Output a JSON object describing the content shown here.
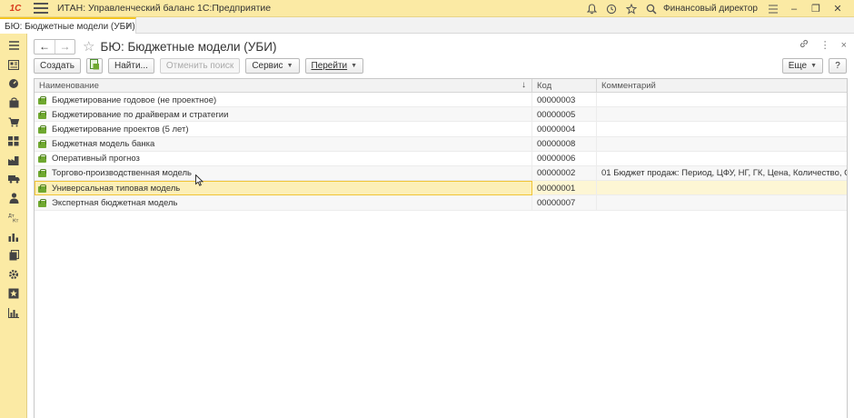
{
  "titlebar": {
    "logo": "1С",
    "app_title": "ИТАН: Управленческий баланс 1С:Предприятие",
    "user": "Финансовый директор"
  },
  "tab": {
    "label": "БЮ: Бюджетные модели (УБИ)",
    "close": "×"
  },
  "form": {
    "title": "БЮ: Бюджетные модели (УБИ)",
    "back": "←",
    "forward": "→",
    "star": "☆"
  },
  "toolbar": {
    "create": "Создать",
    "find": "Найти...",
    "cancel_search": "Отменить поиск",
    "service": "Сервис",
    "go": "Перейти",
    "more": "Еще",
    "help": "?"
  },
  "table": {
    "headers": {
      "name": "Наименование",
      "code": "Код",
      "comment": "Комментарий",
      "sort_indicator": "↓"
    },
    "rows": [
      {
        "name": "Бюджетирование годовое (не проектное)",
        "code": "00000003",
        "comment": ""
      },
      {
        "name": "Бюджетирование по драйверам и стратегии",
        "code": "00000005",
        "comment": ""
      },
      {
        "name": "Бюджетирование проектов (5 лет)",
        "code": "00000004",
        "comment": ""
      },
      {
        "name": "Бюджетная модель банка",
        "code": "00000008",
        "comment": ""
      },
      {
        "name": "Оперативный прогноз",
        "code": "00000006",
        "comment": ""
      },
      {
        "name": "Торгово-производственная модель",
        "code": "00000002",
        "comment": "01  Бюджет продаж:  Период, ЦФУ, НГ, ГК,    Цена, Количество, Сумма ..."
      },
      {
        "name": "Универсальная типовая модель",
        "code": "00000001",
        "comment": ""
      },
      {
        "name": "Экспертная бюджетная модель",
        "code": "00000007",
        "comment": ""
      }
    ],
    "selected_row": 6
  },
  "colors": {
    "accent_yellow": "#fbeaa4",
    "selection_border": "#f0c436",
    "row_icon_green": "#6fa830"
  }
}
